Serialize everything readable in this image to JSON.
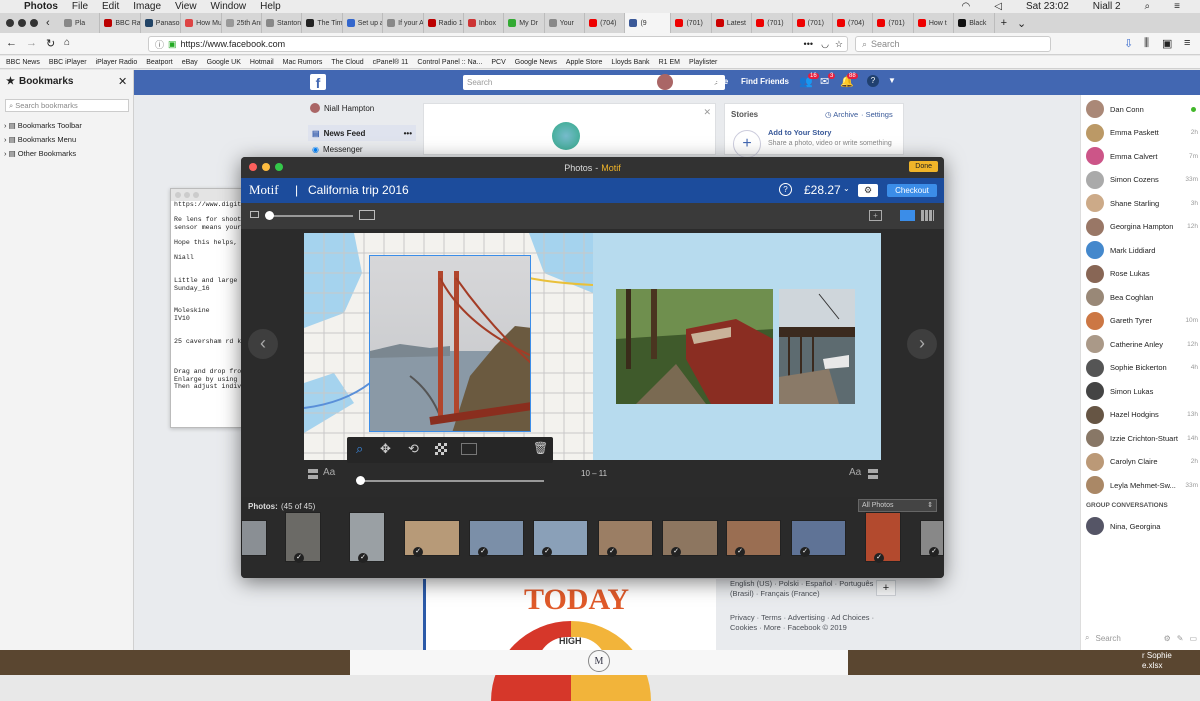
{
  "menubar": {
    "apple": "",
    "app": "Photos",
    "items": [
      "File",
      "Edit",
      "Image",
      "View",
      "Window",
      "Help"
    ],
    "clock": "Sat 23:02",
    "user": "Niall 2"
  },
  "tabs": [
    {
      "label": "Pla",
      "color": "#888"
    },
    {
      "label": "BBC Radio",
      "color": "#b00"
    },
    {
      "label": "Panasonic",
      "color": "#246"
    },
    {
      "label": "How Musi",
      "color": "#d44"
    },
    {
      "label": "25th Anni",
      "color": "#999"
    },
    {
      "label": "Stanton S",
      "color": "#888"
    },
    {
      "label": "The Times",
      "color": "#222"
    },
    {
      "label": "Set up and",
      "color": "#36c"
    },
    {
      "label": "If your Ap",
      "color": "#888"
    },
    {
      "label": "Radio 1 -",
      "color": "#b00"
    },
    {
      "label": "Inbox",
      "color": "#c33"
    },
    {
      "label": "My Dr",
      "color": "#3a3"
    },
    {
      "label": "Your",
      "color": "#888"
    },
    {
      "label": "(704)",
      "color": "#e00"
    },
    {
      "label": "(9",
      "color": "#3b5998"
    },
    {
      "label": "(701)",
      "color": "#e00"
    },
    {
      "label": "Latest",
      "color": "#c00"
    },
    {
      "label": "(701)",
      "color": "#e00"
    },
    {
      "label": "(701)",
      "color": "#e00"
    },
    {
      "label": "(704)",
      "color": "#e00"
    },
    {
      "label": "(701)",
      "color": "#e00"
    },
    {
      "label": "How t",
      "color": "#e00"
    },
    {
      "label": "Black",
      "color": "#111"
    }
  ],
  "nav": {
    "url": "https://www.facebook.com",
    "search_placeholder": "Search"
  },
  "bookmarks_toolbar": [
    "BBC News",
    "BBC iPlayer",
    "iPlayer Radio",
    "Beatport",
    "eBay",
    "Google UK",
    "Hotmail",
    "Mac Rumors",
    "The Cloud",
    "cPanel® 11",
    "Control Panel :: Na...",
    "PCV",
    "Google News",
    "Apple Store",
    "Lloyds Bank",
    "R1 EM",
    "Playlister"
  ],
  "sidebar": {
    "title": "Bookmarks",
    "search_placeholder": "Search bookmarks",
    "items": [
      "Bookmarks Toolbar",
      "Bookmarks Menu",
      "Other Bookmarks"
    ]
  },
  "facebook": {
    "search_placeholder": "Search",
    "user": "Niall",
    "home": "Home",
    "find_friends": "Find Friends",
    "friend_badge": "16",
    "msg_badge": "3",
    "notif_badge": "88",
    "left_nav": [
      "Niall Hampton",
      "News Feed",
      "Messenger"
    ],
    "stories_title": "Stories",
    "archive": "Archive",
    "settings": "Settings",
    "add_story": "Add to Your Story",
    "add_story_sub": "Share a photo, video or write something",
    "languages": "English (US) · Polski · Español · Português (Brasil) · Français (France)",
    "footer": "Privacy · Terms · Advertising · Ad Choices · Cookies · More · Facebook © 2019",
    "today": "TODAY",
    "high": "HIGH"
  },
  "chat": {
    "contacts": [
      {
        "name": "Dan Conn",
        "time": "",
        "online": true,
        "color": "#a87"
      },
      {
        "name": "Emma Paskett",
        "time": "2h",
        "color": "#b96"
      },
      {
        "name": "Emma Calvert",
        "time": "7m",
        "color": "#c58"
      },
      {
        "name": "Simon Cozens",
        "time": "33m",
        "color": "#aaa"
      },
      {
        "name": "Shane Starling",
        "time": "3h",
        "color": "#ca8"
      },
      {
        "name": "Georgina Hampton",
        "time": "12h",
        "color": "#976"
      },
      {
        "name": "Mark Liddiard",
        "time": "",
        "color": "#48c"
      },
      {
        "name": "Rose Lukas",
        "time": "",
        "color": "#865"
      },
      {
        "name": "Bea Coghlan",
        "time": "",
        "color": "#987"
      },
      {
        "name": "Gareth Tyrer",
        "time": "10m",
        "color": "#c74"
      },
      {
        "name": "Catherine Anley",
        "time": "12h",
        "color": "#a98"
      },
      {
        "name": "Sophie Bickerton",
        "time": "4h",
        "color": "#555"
      },
      {
        "name": "Simon Lukas",
        "time": "",
        "color": "#444"
      },
      {
        "name": "Hazel Hodgins",
        "time": "13h",
        "color": "#654"
      },
      {
        "name": "Izzie Crichton-Stuart",
        "time": "14h",
        "color": "#876"
      },
      {
        "name": "Carolyn Claire",
        "time": "2h",
        "color": "#b97"
      },
      {
        "name": "Leyla Mehmet-Sw...",
        "time": "33m",
        "color": "#a86"
      }
    ],
    "group_header": "GROUP CONVERSATIONS",
    "group": "Nina, Georgina",
    "search_placeholder": "Search"
  },
  "textedit": {
    "lines": [
      "https://www.digit",
      "",
      "Re lens for shoot",
      "sensor means your",
      "",
      "Hope this helps,",
      "",
      "Niall",
      "",
      "",
      "Little and large",
      "Sunday_16",
      "",
      "",
      "Moleskine",
      "IV10",
      "",
      "",
      "25 caversham rd k",
      "",
      "",
      "",
      "Drag and drop fro",
      "Enlarge by using",
      "Then adjust indiv"
    ]
  },
  "motif": {
    "window_title": "Photos",
    "window_app": "Motif",
    "done": "Done",
    "logo": "Motif",
    "project": "California trip 2016",
    "price": "£28.27",
    "checkout": "Checkout",
    "page_label": "10 – 11",
    "aa": "Aa",
    "photos_label": "Photos:",
    "photos_count": "(45 of 45)",
    "filter": "All Photos",
    "help": "?"
  },
  "dock": {
    "right_text": "r Sophie",
    "right_file": "e.xlsx"
  }
}
